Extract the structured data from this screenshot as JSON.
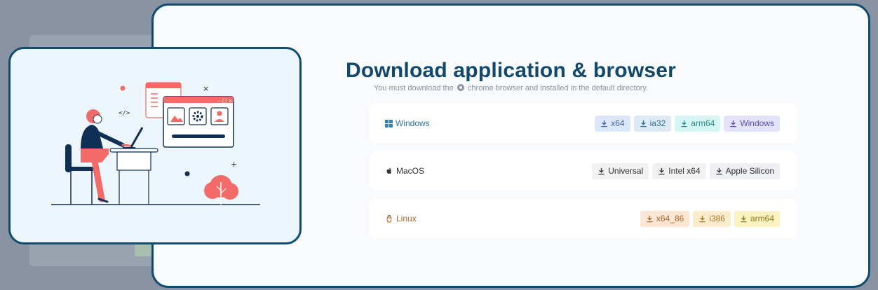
{
  "page": {
    "title": "Download application & browser",
    "subtitle_before": "You must download the",
    "subtitle_after": "chrome browser and installed in the default directory."
  },
  "platforms": [
    {
      "name": "Windows",
      "icon": "windows-icon",
      "color": "#2f6f9f",
      "buttons": [
        {
          "label": "x64",
          "bg": "#dce7fb",
          "fg": "#3f5fae"
        },
        {
          "label": "ia32",
          "bg": "#dde9f5",
          "fg": "#2f6f9f"
        },
        {
          "label": "arm64",
          "bg": "#d6f5f5",
          "fg": "#2a8a8a"
        },
        {
          "label": "Windows",
          "bg": "#e3e2fb",
          "fg": "#5450b0"
        }
      ]
    },
    {
      "name": "MacOS",
      "icon": "apple-icon",
      "color": "#333333",
      "buttons": [
        {
          "label": "Universal",
          "bg": "#f1f1f1",
          "fg": "#333333"
        },
        {
          "label": "Intel x64",
          "bg": "#f1f1f1",
          "fg": "#333333"
        },
        {
          "label": "Apple Silicon",
          "bg": "#eef0f4",
          "fg": "#333333"
        }
      ]
    },
    {
      "name": "Linux",
      "icon": "linux-penguin-icon",
      "color": "#b0662a",
      "buttons": [
        {
          "label": "x64_86",
          "bg": "#fde6d3",
          "fg": "#b0662a"
        },
        {
          "label": "i386",
          "bg": "#fdeccc",
          "fg": "#a8742a"
        },
        {
          "label": "arm64",
          "bg": "#fbf2c2",
          "fg": "#8f7a1c"
        }
      ]
    }
  ],
  "colors": {
    "accent": "#12486b",
    "illustration_accent": "#f26b68",
    "illustration_dark": "#0f2f55"
  }
}
